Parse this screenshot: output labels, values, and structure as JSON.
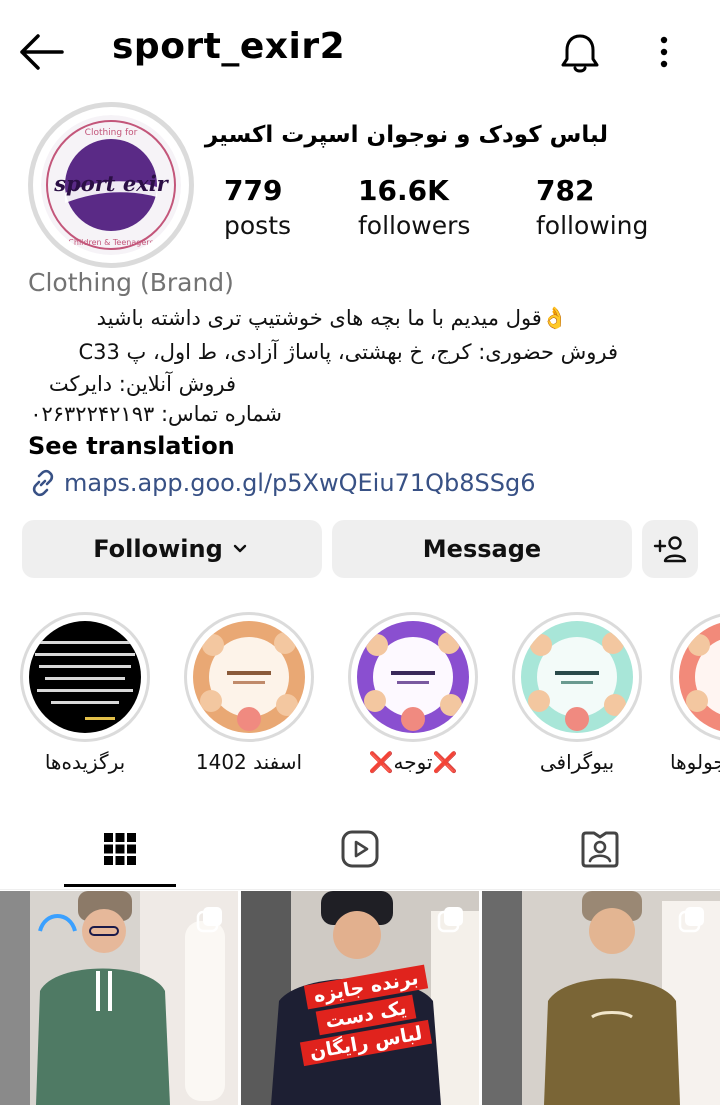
{
  "header": {
    "username": "sport_exir2",
    "back_icon": "arrow-left-icon",
    "notify_icon": "bell-icon",
    "more_icon": "more-vertical-icon"
  },
  "profile": {
    "name": "لباس کودک و نوجوان اسپرت اکسیر",
    "avatar_logo_text": "sport exir",
    "avatar_ring_top": "Clothing for",
    "avatar_ring_bottom": "Children & Teenagers",
    "stats": [
      {
        "value": "779",
        "label": "posts"
      },
      {
        "value": "16.6K",
        "label": "followers"
      },
      {
        "value": "782",
        "label": "following"
      }
    ],
    "category": "Clothing (Brand)",
    "bio": [
      "👌قول میدیم با ما بچه های خوشتیپ تری داشته باشید",
      "فروش حضوری: کرج، خ بهشتی، پاساژ آزادی، ط اول، پ C33",
      "فروش آنلاین: دایرکت",
      "شماره تماس: ۰۲۶۳۲۲۴۲۱۹۳"
    ],
    "see_translation": "See translation",
    "link": "maps.app.goo.gl/p5XwQEiu71Qb8SSg6"
  },
  "actions": {
    "following_label": "Following",
    "message_label": "Message",
    "add_person_icon": "add-person-icon"
  },
  "highlights": [
    {
      "label": "برگزیده‌ها"
    },
    {
      "label": "اسفند 1402"
    },
    {
      "label": "❌توجه❌"
    },
    {
      "label": "بیوگرافی"
    },
    {
      "label": "جولوها"
    }
  ],
  "tabs": [
    {
      "name": "grid",
      "icon": "grid-icon",
      "active": true
    },
    {
      "name": "reels",
      "icon": "reels-icon",
      "active": false
    },
    {
      "name": "tagged",
      "icon": "tagged-icon",
      "active": false
    }
  ],
  "posts": [
    {
      "overlay": []
    },
    {
      "overlay": [
        "برنده جایزه",
        "یک دست",
        "لباس رایگان"
      ]
    },
    {
      "overlay": []
    }
  ],
  "colors": {
    "link": "#385185",
    "button_bg": "#efefef",
    "brand_purple": "#5a2a86"
  }
}
